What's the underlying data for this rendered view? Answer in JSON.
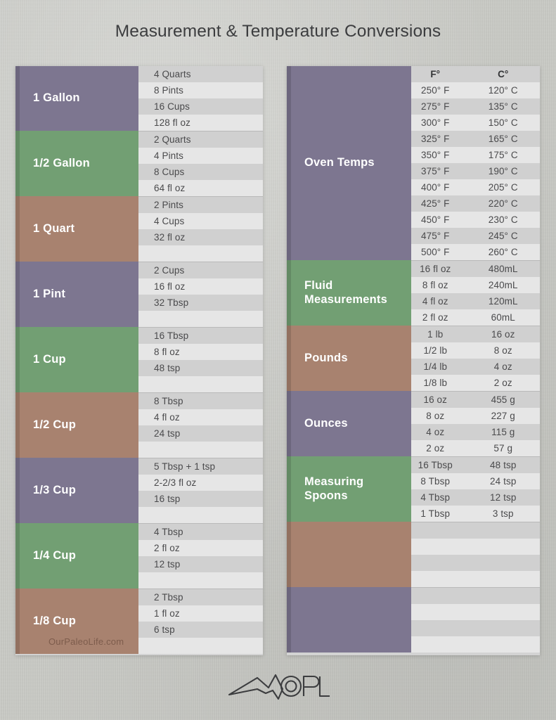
{
  "page": {
    "title": "Measurement & Temperature Conversions",
    "watermark": "OurPaleoLife.com",
    "logo_text": "OPL",
    "logo_icon": "mountain-peak-logo"
  },
  "colors": {
    "purple": "#7d7690",
    "green": "#729f73",
    "brown": "#a8826f",
    "background": "#c9cac5",
    "row_dark": "#d0d0d0",
    "row_light": "#e6e6e6",
    "title_text": "#3c3d3f"
  },
  "left_card": {
    "groups": [
      {
        "label": "1 Gallon",
        "color": "purple",
        "rows": [
          "4 Quarts",
          "8 Pints",
          "16 Cups",
          "128 fl oz"
        ]
      },
      {
        "label": "1/2 Gallon",
        "color": "green",
        "rows": [
          "2 Quarts",
          "4 Pints",
          "8 Cups",
          "64 fl oz"
        ]
      },
      {
        "label": "1 Quart",
        "color": "brown",
        "rows": [
          "2 Pints",
          "4 Cups",
          "32 fl oz",
          ""
        ]
      },
      {
        "label": "1 Pint",
        "color": "purple",
        "rows": [
          "2 Cups",
          "16 fl oz",
          "32 Tbsp",
          ""
        ]
      },
      {
        "label": "1 Cup",
        "color": "green",
        "rows": [
          "16 Tbsp",
          "8 fl oz",
          "48 tsp",
          ""
        ]
      },
      {
        "label": "1/2 Cup",
        "color": "brown",
        "rows": [
          "8 Tbsp",
          "4 fl oz",
          "24 tsp",
          ""
        ]
      },
      {
        "label": "1/3 Cup",
        "color": "purple",
        "rows": [
          "5 Tbsp + 1 tsp",
          "2-2/3 fl oz",
          "16 tsp",
          ""
        ]
      },
      {
        "label": "1/4 Cup",
        "color": "green",
        "rows": [
          "4 Tbsp",
          "2 fl oz",
          "12 tsp",
          ""
        ]
      },
      {
        "label": "1/8 Cup",
        "color": "brown",
        "rows": [
          "2 Tbsp",
          "1 fl oz",
          "6 tsp",
          ""
        ]
      }
    ]
  },
  "right_card": {
    "groups": [
      {
        "label": "Oven Temps",
        "color": "purple",
        "header": [
          "F°",
          "C°"
        ],
        "rows": [
          [
            "250° F",
            "120° C"
          ],
          [
            "275° F",
            "135° C"
          ],
          [
            "300° F",
            "150° C"
          ],
          [
            "325° F",
            "165° C"
          ],
          [
            "350° F",
            "175° C"
          ],
          [
            "375° F",
            "190° C"
          ],
          [
            "400° F",
            "205° C"
          ],
          [
            "425° F",
            "220° C"
          ],
          [
            "450° F",
            "230° C"
          ],
          [
            "475° F",
            "245° C"
          ],
          [
            "500° F",
            "260° C"
          ]
        ]
      },
      {
        "label": "Fluid Measurements",
        "color": "green",
        "rows": [
          [
            "16 fl oz",
            "480mL"
          ],
          [
            "8 fl oz",
            "240mL"
          ],
          [
            "4 fl oz",
            "120mL"
          ],
          [
            "2 fl oz",
            "60mL"
          ]
        ]
      },
      {
        "label": "Pounds",
        "color": "brown",
        "rows": [
          [
            "1 lb",
            "16 oz"
          ],
          [
            "1/2 lb",
            "8 oz"
          ],
          [
            "1/4 lb",
            "4 oz"
          ],
          [
            "1/8 lb",
            "2 oz"
          ]
        ]
      },
      {
        "label": "Ounces",
        "color": "purple",
        "rows": [
          [
            "16 oz",
            "455 g"
          ],
          [
            "8 oz",
            "227 g"
          ],
          [
            "4 oz",
            "115 g"
          ],
          [
            "2 oz",
            "57 g"
          ]
        ]
      },
      {
        "label": "Measuring Spoons",
        "color": "green",
        "rows": [
          [
            "16 Tbsp",
            "48 tsp"
          ],
          [
            "8 Tbsp",
            "24 tsp"
          ],
          [
            "4 Tbsp",
            "12 tsp"
          ],
          [
            "1 Tbsp",
            "3 tsp"
          ]
        ]
      },
      {
        "label": "",
        "color": "brown",
        "rows": [
          [
            "",
            ""
          ],
          [
            "",
            ""
          ],
          [
            "",
            ""
          ],
          [
            "",
            ""
          ]
        ]
      },
      {
        "label": "",
        "color": "purple",
        "rows": [
          [
            "",
            ""
          ],
          [
            "",
            ""
          ],
          [
            "",
            ""
          ],
          [
            "",
            ""
          ]
        ]
      }
    ]
  }
}
